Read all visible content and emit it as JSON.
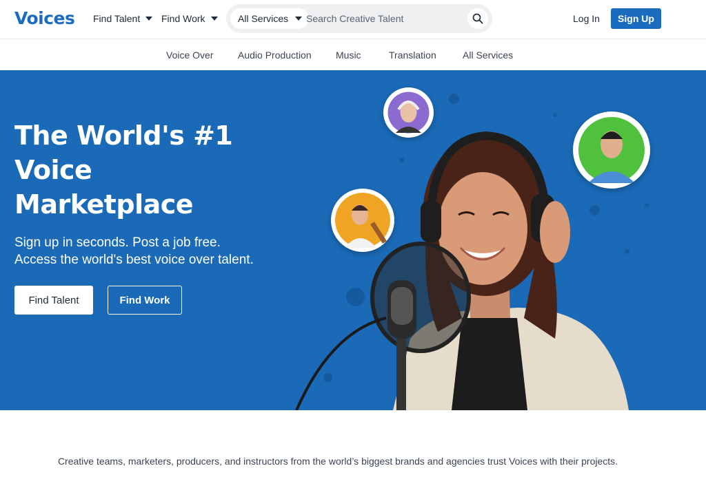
{
  "header": {
    "logo": "Voices",
    "find_talent": "Find Talent",
    "find_work": "Find Work",
    "search_category": "All Services",
    "search_placeholder": "Search Creative Talent",
    "login": "Log In",
    "signup": "Sign Up"
  },
  "subnav": {
    "items": [
      "Voice Over",
      "Audio Production",
      "Music",
      "Translation",
      "All Services"
    ]
  },
  "hero": {
    "title_line1": "The World's #1",
    "title_line2": "Voice",
    "title_line3": "Marketplace",
    "subtitle_line1": "Sign up in seconds. Post a job free.",
    "subtitle_line2": "Access the world's best voice over talent.",
    "btn_find_talent": "Find Talent",
    "btn_find_work": "Find Work"
  },
  "trust": {
    "text": "Creative teams, marketers, producers, and instructors from the world’s biggest brands and agencies trust Voices with their projects."
  },
  "colors": {
    "brand": "#1b6cbf",
    "hero_bg": "#1a6ab7"
  }
}
